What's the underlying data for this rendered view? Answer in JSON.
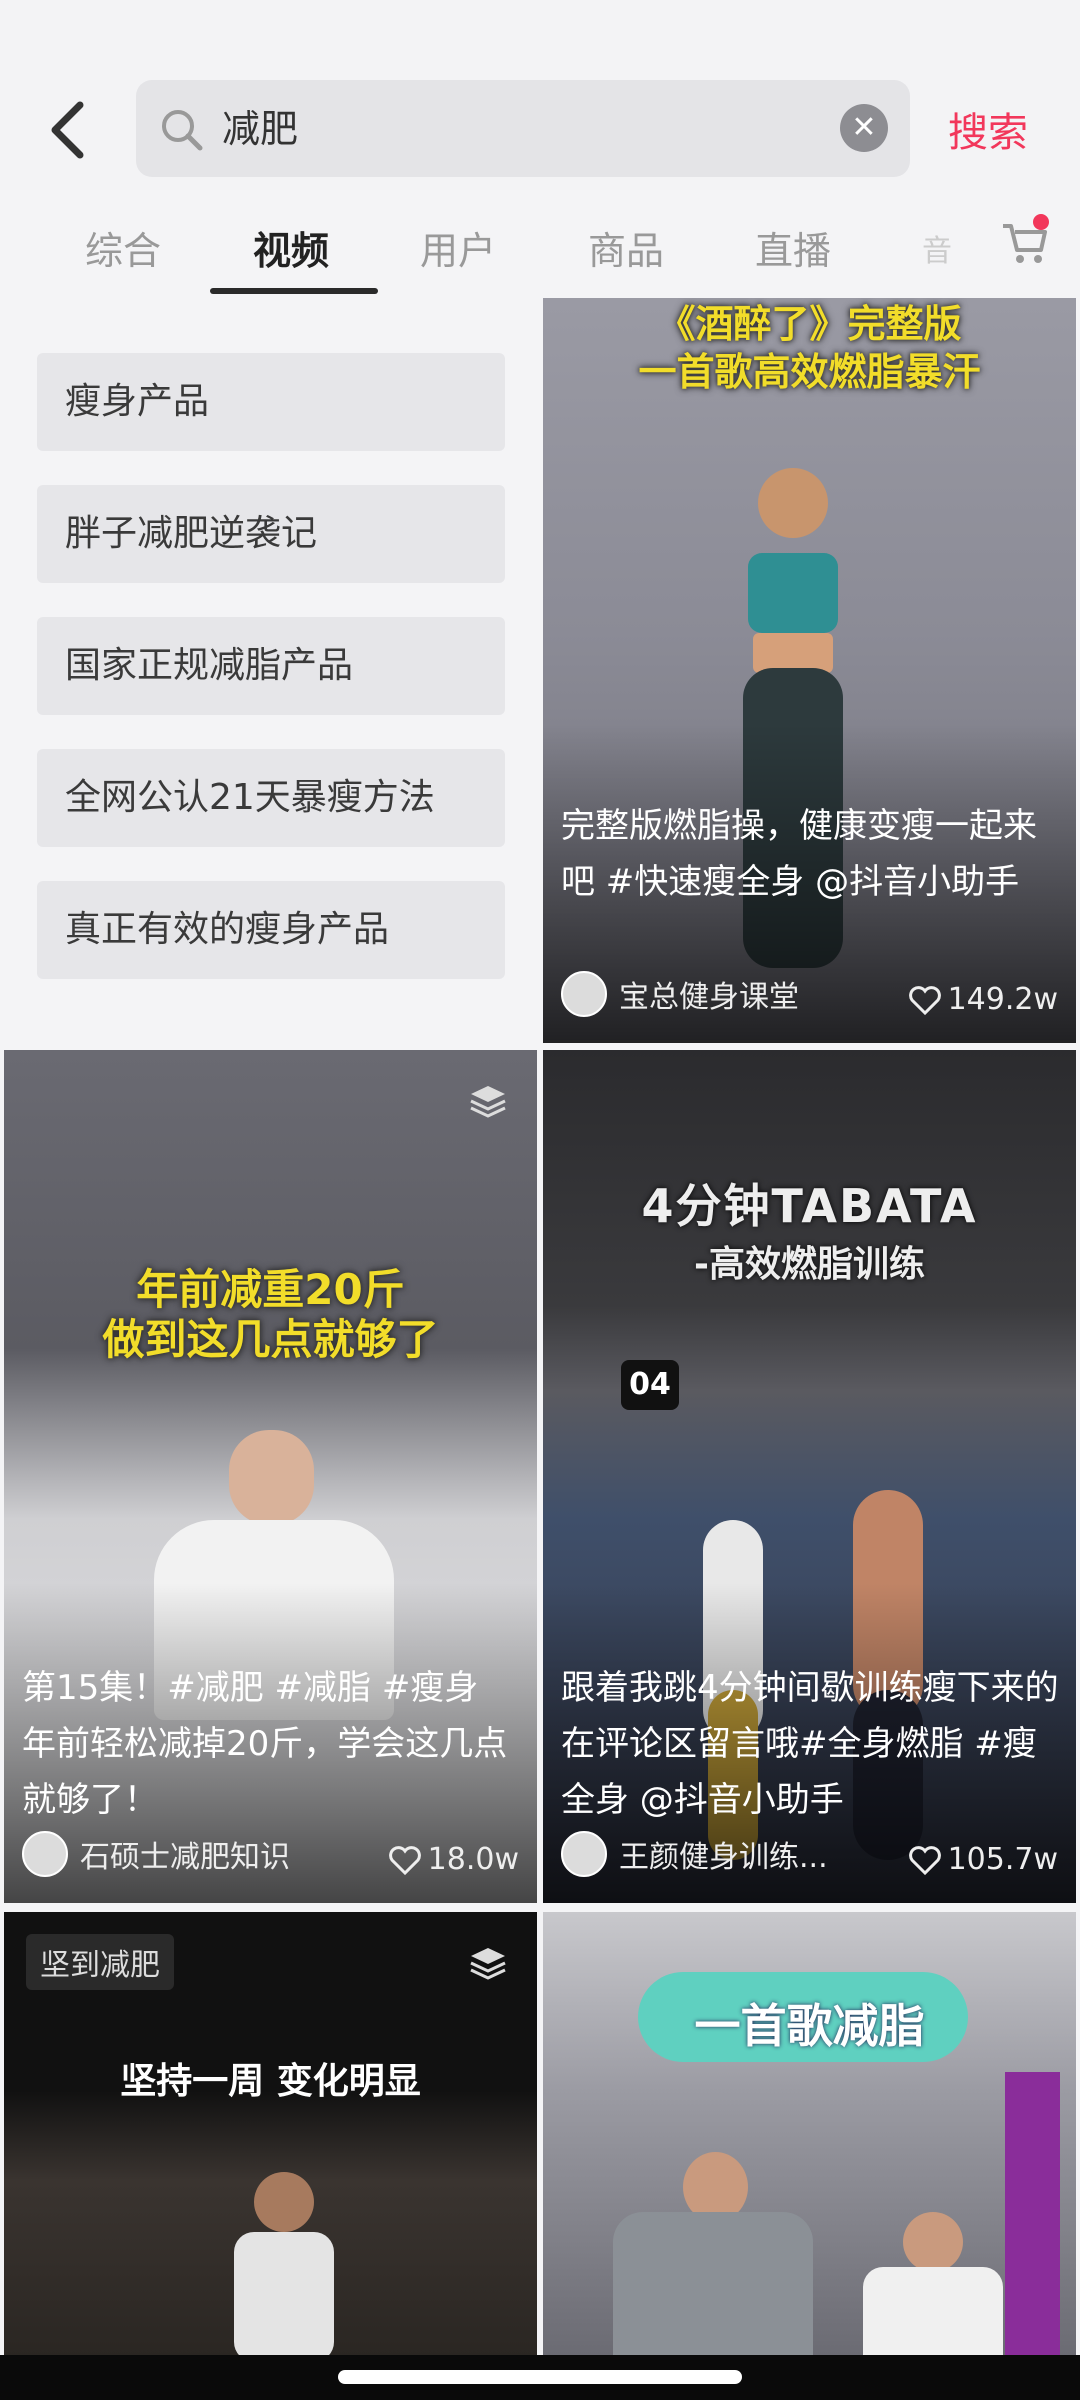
{
  "search": {
    "query": "减肥",
    "button": "搜索"
  },
  "tabs": [
    "综合",
    "视频",
    "用户",
    "商品",
    "直播",
    "音"
  ],
  "active_tab": "视频",
  "suggestions": [
    "瘦身产品",
    "胖子减肥逆袭记",
    "国家正规减脂产品",
    "全网公认21天暴瘦方法",
    "真正有效的瘦身产品"
  ],
  "videos": [
    {
      "cover_lines": [
        "《酒醉了》完整版",
        "一首歌高效燃脂暴汗"
      ],
      "title": "完整版燃脂操，健康变瘦一起来吧 #快速瘦全身 @抖音小助手",
      "author": "宝总健身课堂",
      "likes": "149.2w"
    },
    {
      "cover_lines": [
        "年前减重20斤",
        "做到这几点就够了"
      ],
      "title": "第15集！#减肥 #减脂 #瘦身 年前轻松减掉20斤，学会这几点就够了！",
      "author": "石硕士减肥知识",
      "likes": "18.0w"
    },
    {
      "cover_lines": [
        "4分钟TABATA",
        "-高效燃脂训练"
      ],
      "badge": "04",
      "title": "跟着我跳4分钟间歇训练瘦下来的在评论区留言哦#全身燃脂 #瘦全身 @抖音小助手",
      "author": "王颜健身训练...",
      "likes": "105.7w"
    },
    {
      "tag": "坚到减肥",
      "cover_lines": [
        "坚持一周 变化明显"
      ]
    },
    {
      "cover_lines": [
        "一首歌减脂"
      ]
    }
  ],
  "colors": {
    "accent": "#f2375b",
    "cover_yellow": "#f2dd2a"
  }
}
